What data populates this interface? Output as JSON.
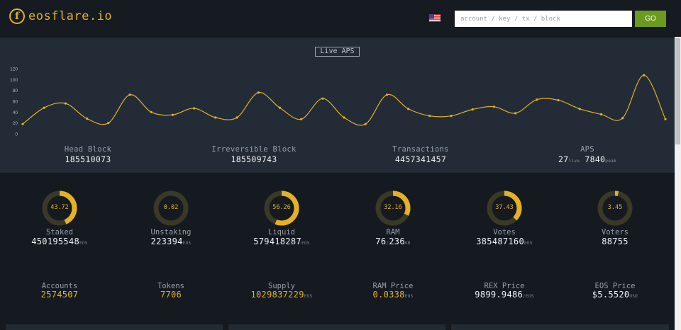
{
  "header": {
    "logo_letter": "f",
    "logo_text": "eosflare.io",
    "flag": "us-flag-icon",
    "search_placeholder": "account / key / tx / block",
    "go_label": "GO"
  },
  "live_chart": {
    "label": "Live APS",
    "y_ticks": [
      "0",
      "20",
      "40",
      "60",
      "80",
      "100",
      "120"
    ]
  },
  "chart_data": {
    "type": "line",
    "title": "Live APS",
    "ylim": [
      0,
      120
    ],
    "series": [
      {
        "values": [
          18,
          48,
          56,
          28,
          20,
          72,
          40,
          35,
          47,
          30,
          30,
          76,
          48,
          27,
          65,
          30,
          18,
          72,
          46,
          33,
          33,
          45,
          50,
          38,
          63,
          62,
          46,
          36,
          29,
          108,
          27
        ]
      }
    ],
    "color": "#e5b124"
  },
  "stats": [
    {
      "label": "Head Block",
      "value": "185510073"
    },
    {
      "label": "Irreversible Block",
      "value": "185509743"
    },
    {
      "label": "Transactions",
      "value": "4457341457"
    },
    {
      "label": "APS",
      "live": "27",
      "live_unit": "live",
      "peak": "7840",
      "peak_unit": "peak"
    }
  ],
  "rings": [
    {
      "pct": "43.72",
      "label": "Staked",
      "value": "450195548",
      "unit": "EOS"
    },
    {
      "pct": "0.02",
      "label": "Unstaking",
      "value": "223394",
      "unit": "EOS"
    },
    {
      "pct": "56.26",
      "label": "Liquid",
      "value": "579418287",
      "unit": "EOS"
    },
    {
      "pct": "32.16",
      "label": "RAM",
      "value": "76",
      "sep": "/",
      "value2": "236",
      "unit": "GB"
    },
    {
      "pct": "37.43",
      "label": "Votes",
      "value": "385487160",
      "unit": "EOS"
    },
    {
      "pct": "3.45",
      "label": "Voters",
      "value": "88755",
      "unit": ""
    }
  ],
  "bottom": [
    {
      "label": "Accounts",
      "value": "2574507",
      "unit": ""
    },
    {
      "label": "Tokens",
      "value": "7706",
      "unit": ""
    },
    {
      "label": "Supply",
      "value": "1029837229",
      "unit": "EOS"
    },
    {
      "label": "RAM Price",
      "value": "0.0338",
      "unit": "EOS"
    },
    {
      "label": "REX Price",
      "value": "9899.9486",
      "unit": "/EOS"
    },
    {
      "label": "EOS Price",
      "value": "$5.5520",
      "unit": "USD"
    }
  ],
  "colors": {
    "accent": "#e5b124",
    "go": "#6b9a1f",
    "panel": "#232b36",
    "bg": "#151a20"
  }
}
